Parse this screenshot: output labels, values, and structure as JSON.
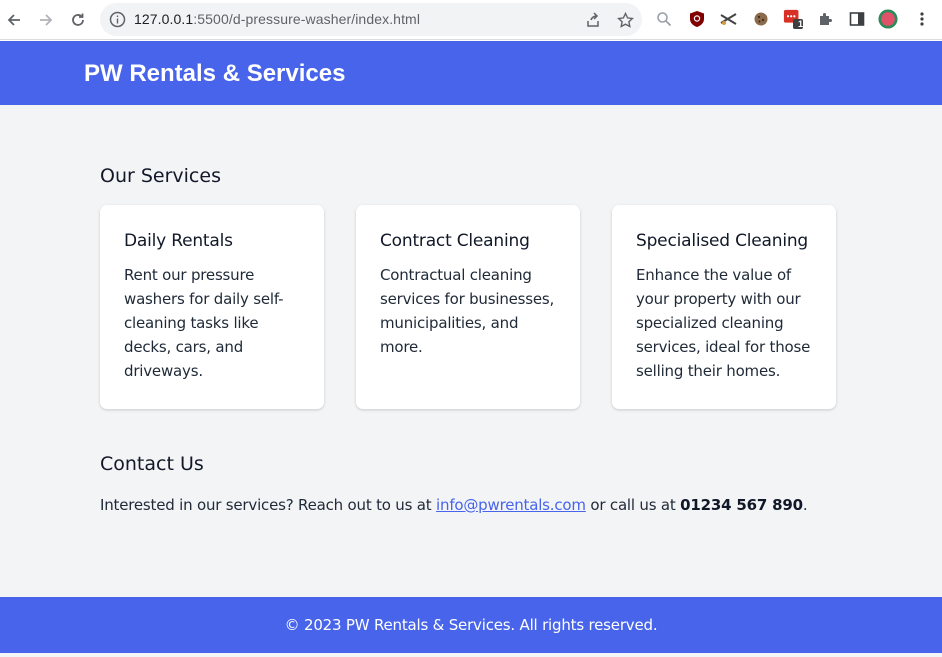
{
  "browser": {
    "url_host": "127.0.0.1",
    "url_rest": ":5500/d-pressure-washer/index.html",
    "extension_badge": "1"
  },
  "header": {
    "title": "PW Rentals & Services"
  },
  "services": {
    "heading": "Our Services",
    "cards": [
      {
        "title": "Daily Rentals",
        "text": "Rent our pressure washers for daily self-cleaning tasks like decks, cars, and driveways."
      },
      {
        "title": "Contract Cleaning",
        "text": "Contractual cleaning services for businesses, municipalities, and more."
      },
      {
        "title": "Specialised Cleaning",
        "text": "Enhance the value of your property with our specialized cleaning services, ideal for those selling their homes."
      }
    ]
  },
  "contact": {
    "heading": "Contact Us",
    "prefix": "Interested in our services? Reach out to us at ",
    "email": "info@pwrentals.com",
    "middle": " or call us at ",
    "phone": "01234 567 890",
    "suffix": "."
  },
  "footer": {
    "text": "© 2023 PW Rentals & Services. All rights reserved."
  },
  "colors": {
    "brand": "#4764eb",
    "page_bg": "#f3f4f6"
  }
}
